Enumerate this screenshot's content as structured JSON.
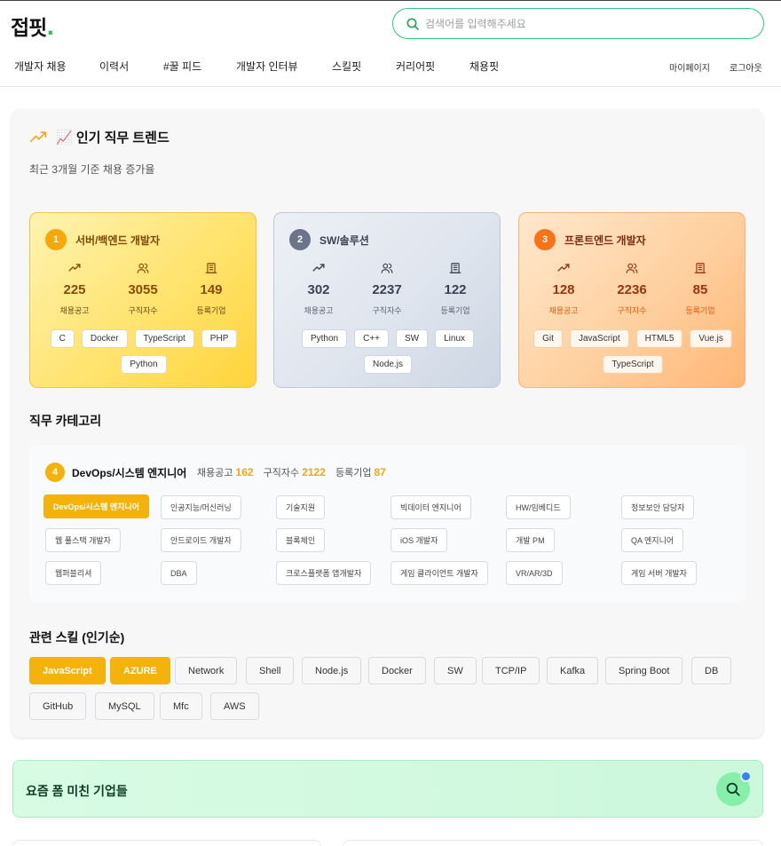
{
  "header": {
    "logo": "접핏",
    "logo_dot": ".",
    "search_placeholder": "검색어를 입력해주세요"
  },
  "nav": {
    "items": [
      "개발자 채용",
      "이력서",
      "#꿀 피드",
      "개발자 인터뷰",
      "스킬핏",
      "커리어핏",
      "채용핏"
    ],
    "right": [
      "마이페이지",
      "로그아웃"
    ]
  },
  "trend": {
    "title": "📈 인기 직무 트렌드",
    "subtitle": "최근 3개월 기준 채용 증가율",
    "stat_labels": [
      "채용공고",
      "구직자수",
      "등록기업"
    ],
    "cards": [
      {
        "rank": "1",
        "name": "서버/백엔드 개발자",
        "stats": [
          "225",
          "3055",
          "149"
        ],
        "tags": [
          "C",
          "Docker",
          "TypeScript",
          "PHP",
          "Python"
        ]
      },
      {
        "rank": "2",
        "name": "SW/솔루션",
        "stats": [
          "302",
          "2237",
          "122"
        ],
        "tags": [
          "Python",
          "C++",
          "SW",
          "Linux",
          "Node.js"
        ]
      },
      {
        "rank": "3",
        "name": "프론트엔드 개발자",
        "stats": [
          "128",
          "2236",
          "85"
        ],
        "tags": [
          "Git",
          "JavaScript",
          "HTML5",
          "Vue.js",
          "TypeScript"
        ]
      }
    ]
  },
  "category": {
    "heading": "직무 카테고리",
    "selected": {
      "rank": "4",
      "name": "DevOps/시스템 엔지니어",
      "label_posts": "채용공고",
      "posts": "162",
      "label_seekers": "구직자수",
      "seekers": "2122",
      "label_companies": "등록기업",
      "companies": "87"
    },
    "chips": [
      "DevOps/시스템 엔지니어",
      "인공지능/머신러닝",
      "기술지원",
      "빅데이터 엔지니어",
      "HW/임베디드",
      "정보보안 담당자",
      "웹 풀스택 개발자",
      "안드로이드 개발자",
      "블록체인",
      "iOS 개발자",
      "개발 PM",
      "QA 엔지니어",
      "웹퍼블리셔",
      "DBA",
      "크로스플랫폼 앱개발자",
      "게임 클라이언트 개발자",
      "VR/AR/3D",
      "게임 서버 개발자"
    ]
  },
  "skills": {
    "heading": "관련 스킬 (인기순)",
    "items": [
      "JavaScript",
      "AZURE",
      "Network",
      "Shell",
      "Node.js",
      "Docker",
      "SW",
      "TCP/IP",
      "Kafka",
      "Spring Boot",
      "DB",
      "GitHub",
      "MySQL",
      "Mfc",
      "AWS"
    ]
  },
  "hot": {
    "title": "요즘 폼 미친 기업들"
  },
  "colors": {
    "accent": "#f5b20b",
    "green": "#22c55e",
    "search_border": "#34c77b"
  }
}
